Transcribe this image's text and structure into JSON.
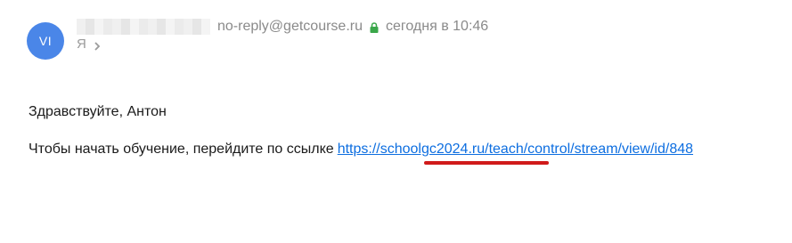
{
  "sender": {
    "avatar_initials": "VI",
    "avatar_color": "#4a86e8",
    "email": "no-reply@getcourse.ru",
    "date": "сегодня в 10:46"
  },
  "recipient": {
    "label": "Я"
  },
  "message": {
    "greeting": "Здравствуйте, Антон",
    "body_text": "Чтобы начать обучение, перейдите по ссылке",
    "link_text": "https://schoolgc2024.ru/teach/control/stream/view/id/848"
  },
  "colors": {
    "lock_green": "#3aa74a",
    "link_blue": "#0d6ee0",
    "highlight_red": "#d01a1a"
  },
  "icons": {
    "lock": "lock-icon",
    "chevron": "chevron-right-icon"
  }
}
